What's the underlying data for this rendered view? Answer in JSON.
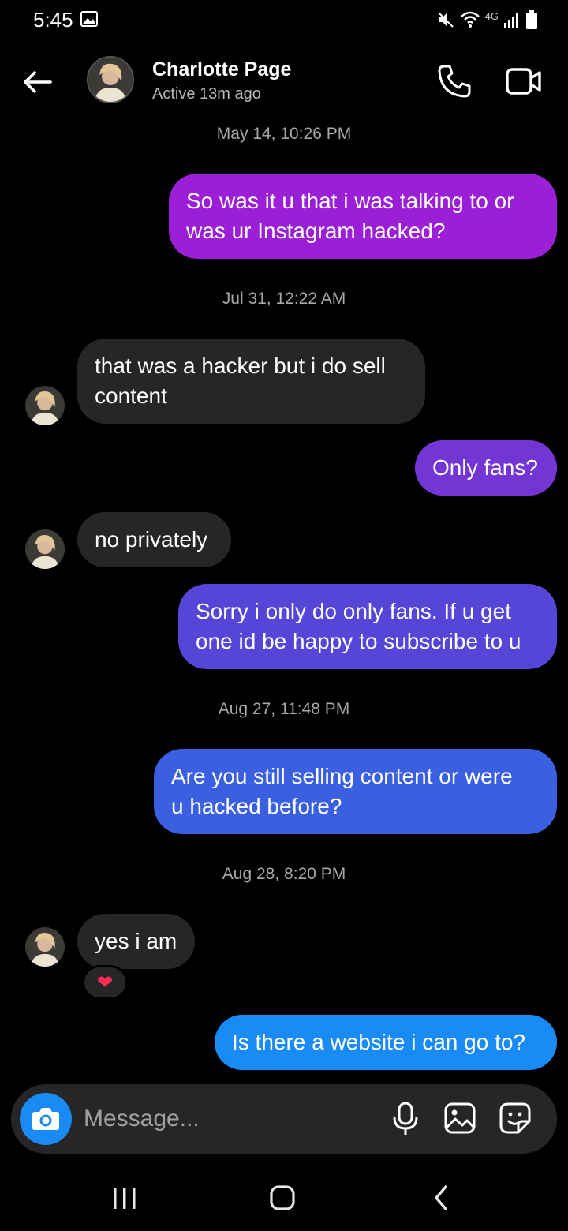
{
  "status_bar": {
    "time": "5:45",
    "network": "4G"
  },
  "header": {
    "back_icon": "arrow-left-icon",
    "name": "Charlotte Page",
    "status": "Active 13m ago",
    "call_icon": "phone-icon",
    "video_icon": "video-camera-icon"
  },
  "thread": {
    "timestamps": [
      "May 14, 10:26 PM",
      "Jul 31, 12:22 AM",
      "Aug 27, 11:48 PM",
      "Aug 28, 8:20 PM"
    ],
    "messages": [
      {
        "direction": "outgoing",
        "line1": "So was it u that i was talking to or",
        "line2": "was ur Instagram hacked?",
        "color": "#9b1fd6"
      },
      {
        "direction": "incoming",
        "line1": "that was a hacker but i do sell",
        "line2": "content"
      },
      {
        "direction": "outgoing",
        "line1": "Only fans?",
        "color": "#7335d4"
      },
      {
        "direction": "incoming",
        "line1": "no privately"
      },
      {
        "direction": "outgoing",
        "line1": "Sorry i only do only fans. If u get",
        "line2": "one id be happy to subscribe to u",
        "color": "#5646d8"
      },
      {
        "direction": "outgoing",
        "line1": "Are you still selling content or were",
        "line2": "u hacked before?",
        "color": "#3a5fe0"
      },
      {
        "direction": "incoming",
        "line1": "yes i am",
        "reaction": "❤"
      },
      {
        "direction": "outgoing",
        "line1": "Is there a website i can go to?",
        "color": "#1a8af5"
      }
    ]
  },
  "composer": {
    "placeholder": "Message...",
    "camera_icon": "camera-icon",
    "mic_icon": "microphone-icon",
    "gallery_icon": "image-icon",
    "sticker_icon": "sticker-icon",
    "accent": "#1a8af5"
  },
  "nav": {
    "recent_icon": "recent-apps-icon",
    "home_icon": "home-icon",
    "back_icon": "nav-back-icon"
  }
}
